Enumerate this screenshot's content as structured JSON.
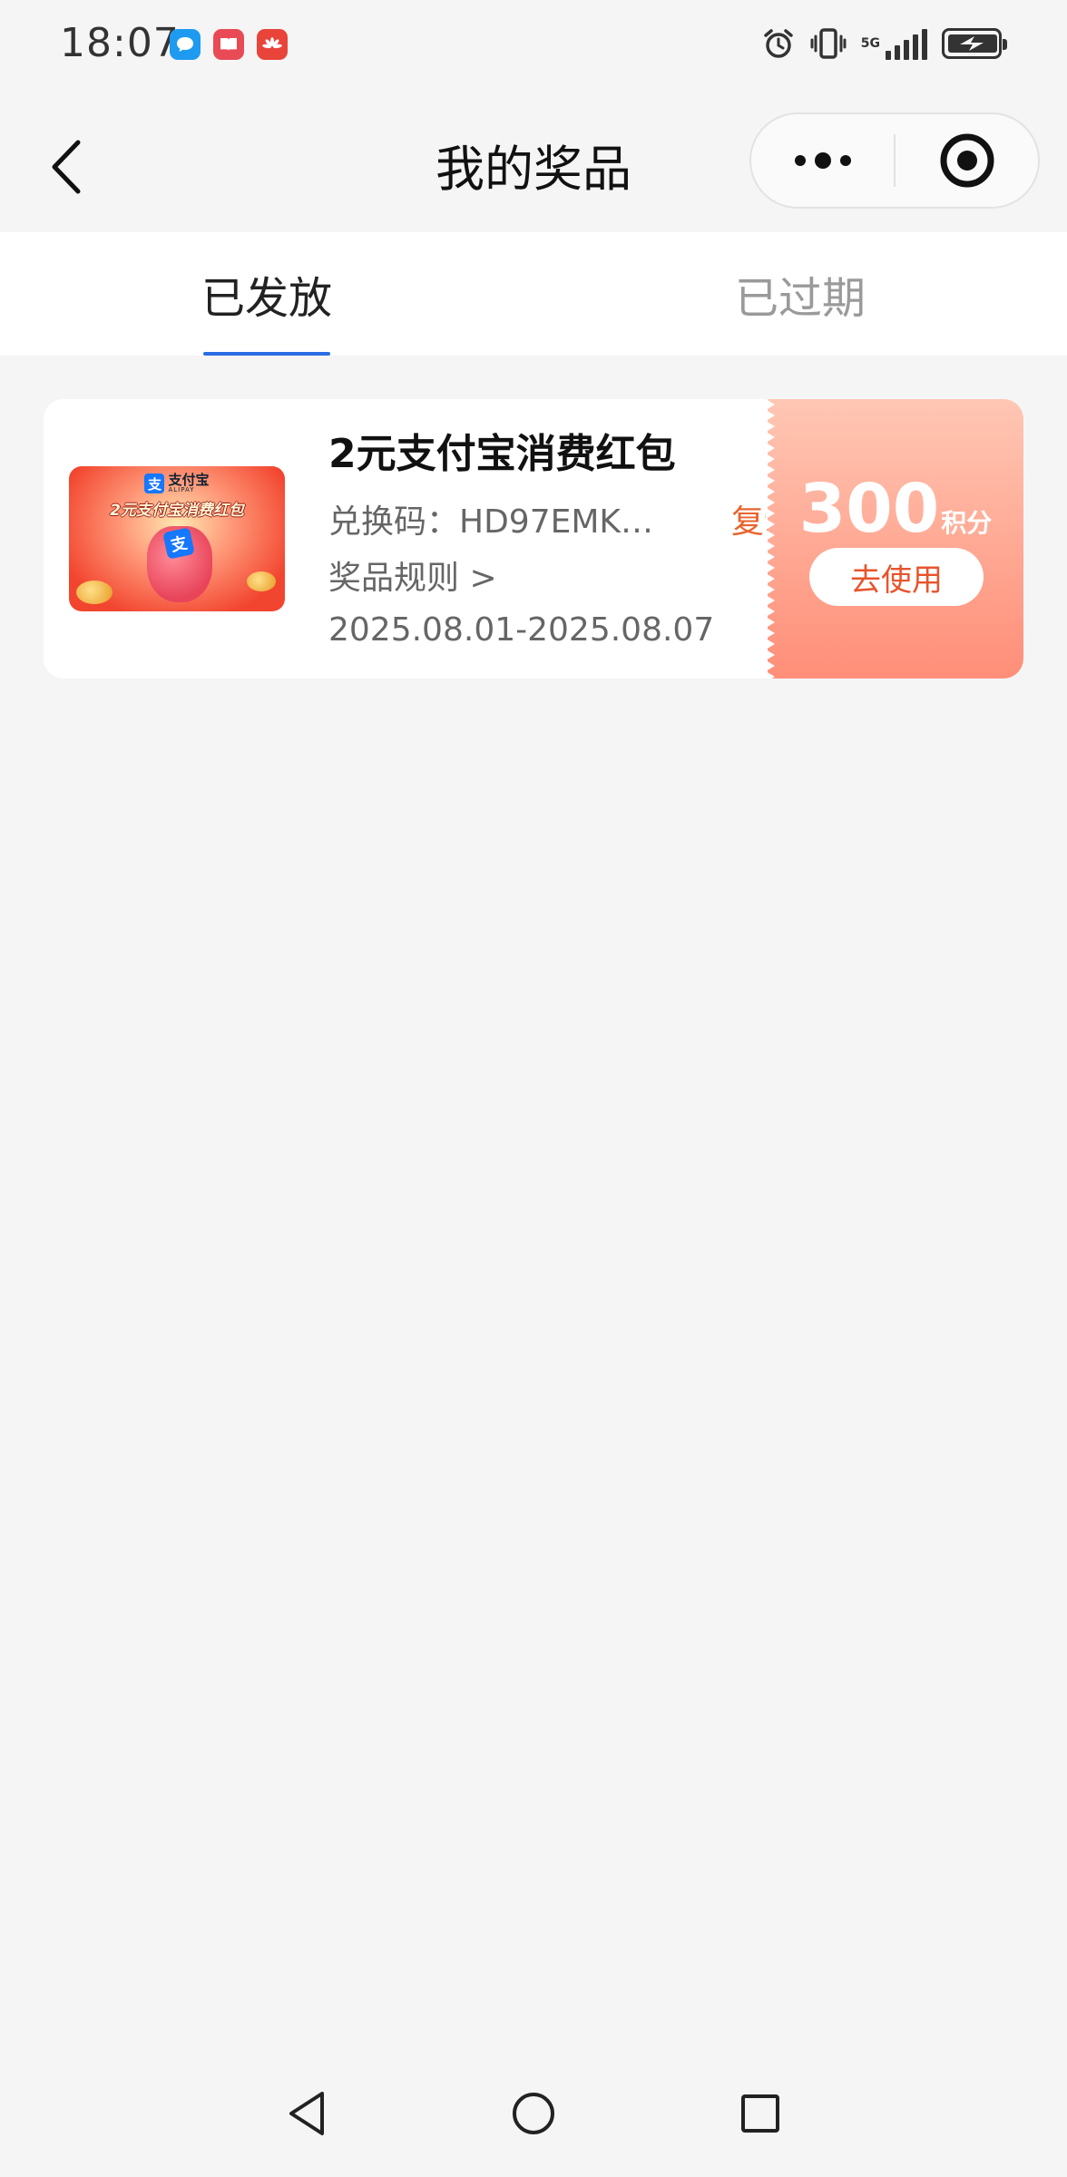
{
  "status_bar": {
    "time": "18:07",
    "notifications": [
      {
        "icon": "message-icon",
        "color": "#1e9bf0"
      },
      {
        "icon": "book-icon",
        "color": "#e84b55"
      },
      {
        "icon": "huawei-icon",
        "color": "#e8443a"
      }
    ],
    "network_label": "5G",
    "icons": [
      "alarm-icon",
      "vibrate-icon",
      "signal-icon",
      "battery-charging-icon"
    ]
  },
  "header": {
    "title": "我的奖品",
    "back_icon": "chevron-left-icon",
    "more_icon": "more-dots-icon",
    "close_icon": "target-circle-icon"
  },
  "tabs": [
    {
      "label": "已发放",
      "active": true
    },
    {
      "label": "已过期",
      "active": false
    }
  ],
  "colors": {
    "accent_blue": "#2b6de5",
    "accent_orange": "#e8642c",
    "coupon_gradient_top": "#ffc7b4",
    "coupon_gradient_bottom": "#ff8e78",
    "page_bg": "#f5f5f6"
  },
  "prize": {
    "title": "2元支付宝消费红包",
    "thumbnail": {
      "brand": "支付宝",
      "brand_sub": "ALIPAY",
      "banner_text": "2元支付宝消费红包"
    },
    "code_text": "兑换码：HD97EMK…",
    "copy_label": "复制",
    "rules_label": "奖品规则 >",
    "date_range": "2025.08.01-2025.08.07",
    "points_value": "300",
    "points_unit": "积分",
    "use_label": "去使用"
  },
  "system_nav": [
    "back-triangle-icon",
    "home-circle-icon",
    "recents-square-icon"
  ]
}
